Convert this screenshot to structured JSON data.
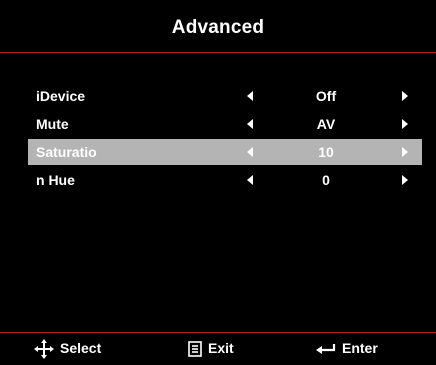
{
  "window": {
    "title": "Advanced"
  },
  "menu": {
    "items": [
      {
        "label": "iDevice",
        "value": "Off",
        "selected": false
      },
      {
        "label": "Mute",
        "value": "AV",
        "selected": false
      },
      {
        "label": "Saturatio",
        "value": "10",
        "selected": true
      },
      {
        "label": "n Hue",
        "value": "0",
        "selected": false
      }
    ]
  },
  "footer": {
    "select_label": "Select",
    "exit_label": "Exit",
    "enter_label": "Enter",
    "select_icon": "four-way-arrow-icon",
    "exit_icon": "menu-icon",
    "enter_icon": "return-arrow-icon"
  },
  "colors": {
    "background": "#000000",
    "divider": "#b3202a",
    "highlight": "#b4b4b4",
    "text": "#ffffff"
  }
}
